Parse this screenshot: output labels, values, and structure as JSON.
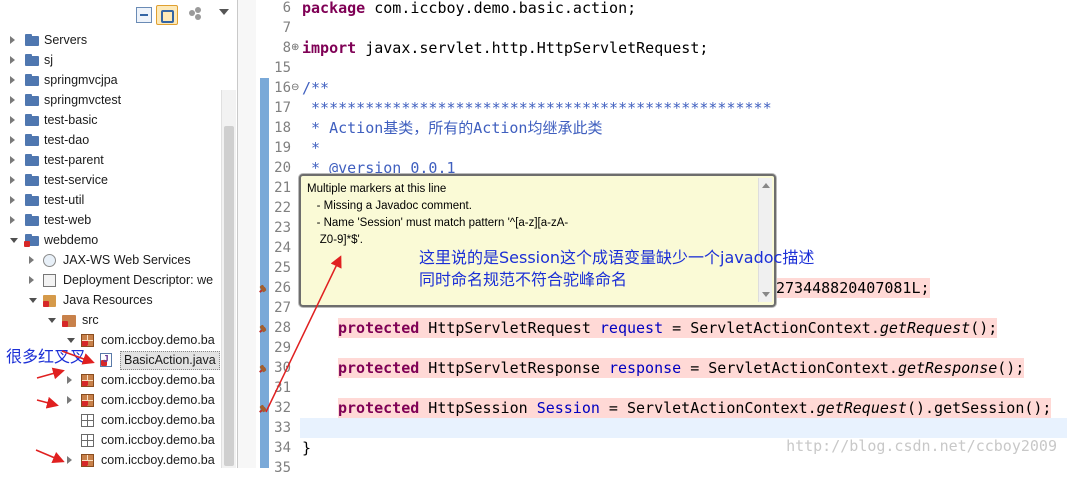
{
  "tree": {
    "items": [
      {
        "label": "Servers",
        "icon": "project-folder-icon"
      },
      {
        "label": "sj",
        "icon": "project-folder-icon"
      },
      {
        "label": "springmvcjpa",
        "icon": "project-folder-icon"
      },
      {
        "label": "springmvctest",
        "icon": "project-folder-icon"
      },
      {
        "label": "test-basic",
        "icon": "project-folder-icon"
      },
      {
        "label": "test-dao",
        "icon": "project-folder-icon"
      },
      {
        "label": "test-parent",
        "icon": "project-folder-icon"
      },
      {
        "label": "test-service",
        "icon": "project-folder-icon"
      },
      {
        "label": "test-util",
        "icon": "project-folder-icon"
      },
      {
        "label": "test-web",
        "icon": "project-folder-icon"
      },
      {
        "label": "webdemo",
        "icon": "project-folder-icon"
      },
      {
        "label": "JAX-WS Web Services",
        "icon": "web-services-icon"
      },
      {
        "label": "Deployment Descriptor: we",
        "icon": "deployment-descriptor-icon"
      },
      {
        "label": "Java Resources",
        "icon": "java-resources-icon"
      },
      {
        "label": "src",
        "icon": "source-folder-icon"
      },
      {
        "label": "com.iccboy.demo.ba",
        "icon": "package-icon"
      },
      {
        "label": "BasicAction.java",
        "icon": "java-file-icon"
      },
      {
        "label": "com.iccboy.demo.ba",
        "icon": "package-icon"
      },
      {
        "label": "com.iccboy.demo.ba",
        "icon": "package-icon"
      },
      {
        "label": "com.iccboy.demo.ba",
        "icon": "empty-package-icon"
      },
      {
        "label": "com.iccboy.demo.ba",
        "icon": "empty-package-icon"
      },
      {
        "label": "com.iccboy.demo.ba",
        "icon": "package-icon"
      }
    ]
  },
  "editor": {
    "line_numbers": [
      "6",
      "7",
      "8",
      "15",
      "16",
      "17",
      "18",
      "19",
      "20",
      "21",
      "22",
      "23",
      "24",
      "25",
      "26",
      "27",
      "28",
      "29",
      "30",
      "31",
      "32",
      "33",
      "34",
      "35"
    ],
    "lines": {
      "l6_kw": "package",
      "l6_rest": " com.iccboy.demo.basic.action;",
      "l8_kw": "import",
      "l8_rest": " javax.servlet.http.HttpServletRequest;",
      "l16": "/**",
      "l17": " ***************************************************",
      "l18": " * Action基类，所有的Action均继承此类",
      "l19": " *",
      "l20": " * @version 0.0.1",
      "l26_tail": "273448820407081L;",
      "l28_kw": "protected",
      "l28_rest": " HttpServletRequest ",
      "l28_field": "request",
      "l28_eq": " = ServletActionContext.",
      "l28_call": "getRequest",
      "l28_end": "();",
      "l30_kw": "protected",
      "l30_rest": " HttpServletResponse ",
      "l30_field": "response",
      "l30_eq": " = ServletActionContext.",
      "l30_call": "getResponse",
      "l30_end": "();",
      "l32_kw": "protected",
      "l32_rest": " HttpSession ",
      "l32_field": "Session",
      "l32_eq": " = ServletActionContext.",
      "l32_call": "getRequest",
      "l32_end": "().getSession();",
      "l34": "}"
    }
  },
  "tooltip": {
    "text": "Multiple markers at this line\n   - Missing a Javadoc comment.\n   - Name 'Session' must match pattern '^[a-z][a-zA-\n    Z0-9]*$'."
  },
  "annotations": {
    "note_line1": "这里说的是Session这个成语变量缺少一个javadoc描述",
    "note_line2": "同时命名规范不符合驼峰命名",
    "left_note": "很多红叉叉"
  },
  "watermark": "http://blog.csdn.net/ccboy2009",
  "colors": {
    "keyword": "#7f0055",
    "comment": "#3f5fbf",
    "field": "#0000c0",
    "error_line": "#ffd9d6",
    "annotation": "#1b2fd6",
    "arrow": "#e02020"
  }
}
